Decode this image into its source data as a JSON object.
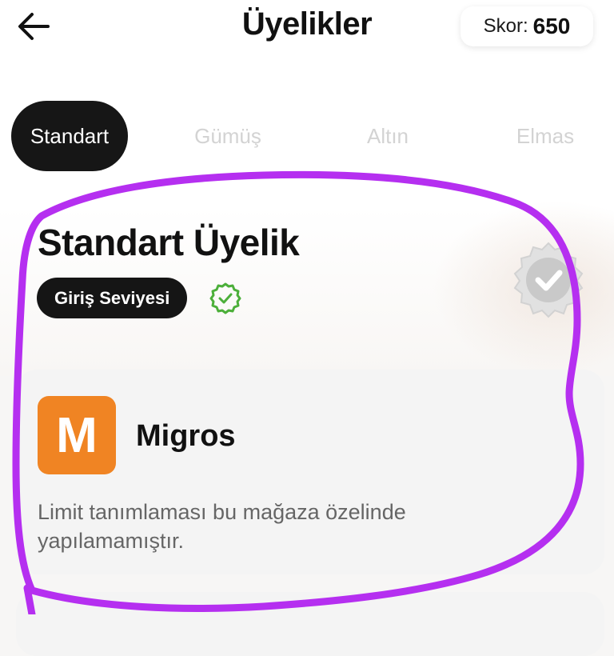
{
  "header": {
    "title": "Üyelikler",
    "score_label": "Skor:",
    "score_value": "650"
  },
  "tabs": [
    {
      "label": "Standart",
      "active": true
    },
    {
      "label": "Gümüş",
      "active": false
    },
    {
      "label": "Altın",
      "active": false
    },
    {
      "label": "Elmas",
      "active": false
    }
  ],
  "membership": {
    "title": "Standart Üyelik",
    "level_badge": "Giriş Seviyesi"
  },
  "store": {
    "logo_letter": "M",
    "name": "Migros",
    "description": "Limit tanımlaması bu mağaza özelinde yapılamamıştır."
  },
  "colors": {
    "background": "#ffffff",
    "dark": "#151515",
    "inactive_tab": "#d3d3d3",
    "verified_green": "#4caf3a",
    "store_orange": "#f08423",
    "annotation_purple": "#b52ff0"
  },
  "icons": {
    "back": "arrow-left-icon",
    "verified": "check-circle-icon",
    "seal": "badge-seal-icon"
  }
}
